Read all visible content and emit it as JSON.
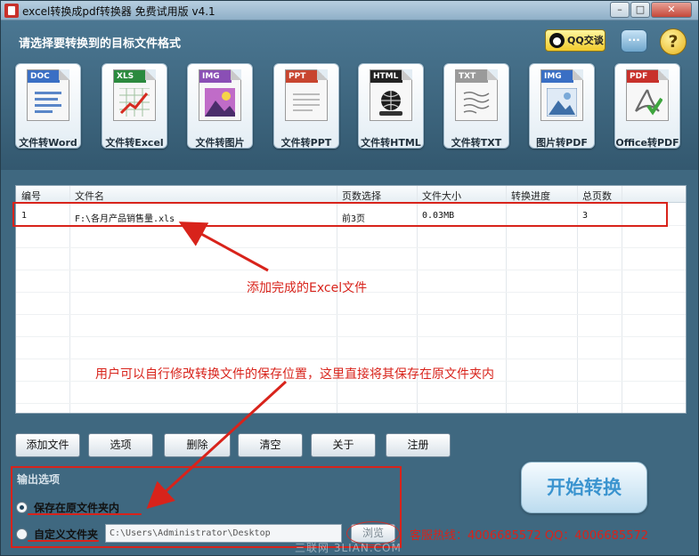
{
  "window": {
    "title": "excel转换成pdf转换器 免费试用版 v4.1",
    "controls": [
      "–",
      "□",
      "✕"
    ]
  },
  "header": {
    "title": "请选择要转换到的目标文件格式",
    "qq_label": "QQ交谈",
    "chat_label": "···",
    "help_label": "?"
  },
  "formats": [
    {
      "badge": "DOC",
      "label": "文件转Word",
      "color": "#3a6fc4",
      "icon": "word-doc-icon"
    },
    {
      "badge": "XLS",
      "label": "文件转Excel",
      "color": "#2b8a3e",
      "icon": "excel-chart-icon"
    },
    {
      "badge": "IMG",
      "label": "文件转图片",
      "color": "#8a4fb5",
      "icon": "image-icon"
    },
    {
      "badge": "PPT",
      "label": "文件转PPT",
      "color": "#c8452f",
      "icon": "powerpoint-icon"
    },
    {
      "badge": "HTML",
      "label": "文件转HTML",
      "color": "#222222",
      "icon": "html-globe-icon"
    },
    {
      "badge": "TXT",
      "label": "文件转TXT",
      "color": "#9a9a9a",
      "icon": "text-doc-icon"
    },
    {
      "badge": "IMG",
      "label": "图片转PDF",
      "color": "#3a6fc4",
      "icon": "picture-icon"
    },
    {
      "badge": "PDF",
      "label": "Office转PDF",
      "color": "#c8312b",
      "icon": "pdf-icon"
    }
  ],
  "table": {
    "columns": [
      "编号",
      "文件名",
      "页数选择",
      "文件大小",
      "转换进度",
      "总页数"
    ],
    "rows": [
      {
        "index": "1",
        "filename": "F:\\各月产品销售量.xls",
        "pages": "前3页",
        "size": "0.03MB",
        "progress": "",
        "total": "3"
      }
    ]
  },
  "toolbar": {
    "add_file": "添加文件",
    "options": "选项",
    "delete": "删除",
    "clear": "清空",
    "about": "关于",
    "register": "注册"
  },
  "output": {
    "label": "输出选项",
    "option_original": "保存在原文件夹内",
    "option_custom": "自定义文件夹",
    "path": "C:\\Users\\Administrator\\Desktop",
    "browse": "浏览",
    "selected": "original"
  },
  "start_button": "开始转换",
  "hotline": "客服热线：4006685572 QQ：4006685572",
  "annotations": {
    "added_note": "添加完成的Excel文件",
    "save_note": "用户可以自行修改转换文件的保存位置，这里直接将其保存在原文件夹内"
  },
  "watermark": "三联网 3LIAN.COM",
  "colors": {
    "annotation": "#d8231b",
    "start_text": "#3b94cf"
  }
}
